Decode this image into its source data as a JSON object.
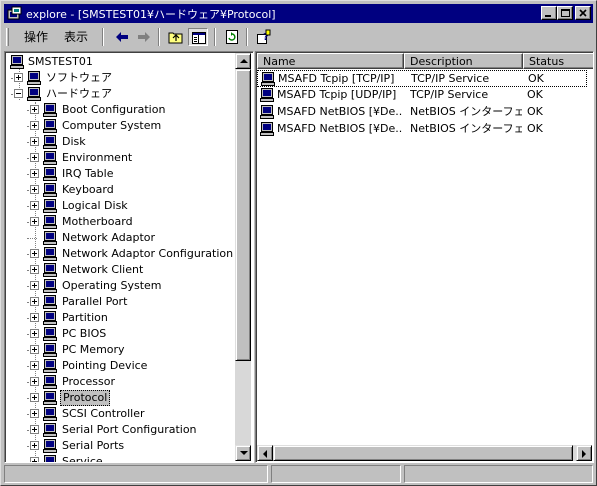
{
  "window": {
    "title": "explore - [SMSTEST01¥ハードウェア¥Protocol]",
    "title_bg": "#000080"
  },
  "toolbar": {
    "menu_operation": "操作",
    "menu_view": "表示",
    "icons": [
      "back-arrow-icon",
      "forward-arrow-icon",
      "up-folder-icon",
      "show-hide-tree-icon",
      "refresh-icon",
      "help-icon"
    ]
  },
  "tree": {
    "root": "SMSTEST01",
    "software": "ソフトウェア",
    "hardware": "ハードウェア",
    "items": [
      "Boot Configuration",
      "Computer System",
      "Disk",
      "Environment",
      "IRQ Table",
      "Keyboard",
      "Logical Disk",
      "Motherboard",
      "Network Adaptor",
      "Network Adaptor Configuration",
      "Network Client",
      "Operating System",
      "Parallel Port",
      "Partition",
      "PC BIOS",
      "PC Memory",
      "Pointing Device",
      "Processor",
      "Protocol",
      "SCSI Controller",
      "Serial Port Configuration",
      "Serial Ports",
      "Service"
    ],
    "selected": "Protocol"
  },
  "list": {
    "columns": [
      "Name",
      "Description",
      "Status"
    ],
    "rows": [
      {
        "name": "MSAFD Tcpip [TCP/IP]",
        "description": "TCP/IP Service",
        "status": "OK"
      },
      {
        "name": "MSAFD Tcpip [UDP/IP]",
        "description": "TCP/IP Service",
        "status": "OK"
      },
      {
        "name": "MSAFD NetBIOS [¥De...",
        "description": "NetBIOS インターフェイス",
        "status": "OK"
      },
      {
        "name": "MSAFD NetBIOS [¥De...",
        "description": "NetBIOS インターフェイス",
        "status": "OK"
      }
    ]
  }
}
